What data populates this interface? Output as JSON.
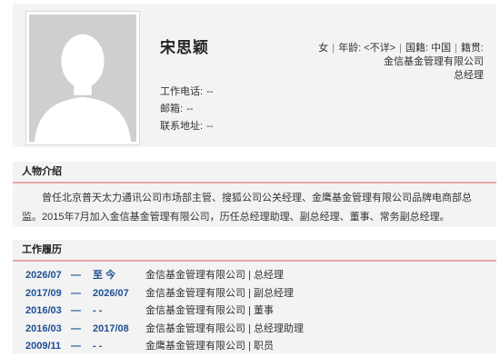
{
  "profile": {
    "name": "宋思颖",
    "gender": "女",
    "age_label": "年龄:",
    "age_value": "<不详>",
    "nationality_label": "国籍:",
    "nationality_value": "中国",
    "native_place_label": "籍贯:",
    "company": "金信基金管理有限公司",
    "position": "总经理",
    "phone_label": "工作电话:",
    "phone_value": "--",
    "email_label": "邮箱:",
    "email_value": "--",
    "address_label": "联系地址:",
    "address_value": "--"
  },
  "bio": {
    "title": "人物介绍",
    "text": "曾任北京普天太力通讯公司市场部主管、搜狐公司公关经理、金鹰基金管理有限公司品牌电商部总监。2015年7月加入金信基金管理有限公司，历任总经理助理、副总经理、董事、常务副总经理。"
  },
  "career": {
    "title": "工作履历",
    "rows": [
      {
        "start": "2026/07",
        "dash": "—",
        "end": "至 今",
        "desc": "金信基金管理有限公司 | 总经理"
      },
      {
        "start": "2017/09",
        "dash": "—",
        "end": "2026/07",
        "desc": "金信基金管理有限公司 | 副总经理"
      },
      {
        "start": "2016/03",
        "dash": "—",
        "end": "- -",
        "desc": "金信基金管理有限公司 | 董事"
      },
      {
        "start": "2016/03",
        "dash": "—",
        "end": "2017/08",
        "desc": "金信基金管理有限公司 | 总经理助理"
      },
      {
        "start": "2009/11",
        "dash": "—",
        "end": "- -",
        "desc": "金鹰基金管理有限公司 | 职员"
      }
    ]
  },
  "colors": {
    "date_blue": "#1e4f94",
    "divider_pink": "#e8a6a6",
    "panel_gray": "#f3f3f3"
  }
}
